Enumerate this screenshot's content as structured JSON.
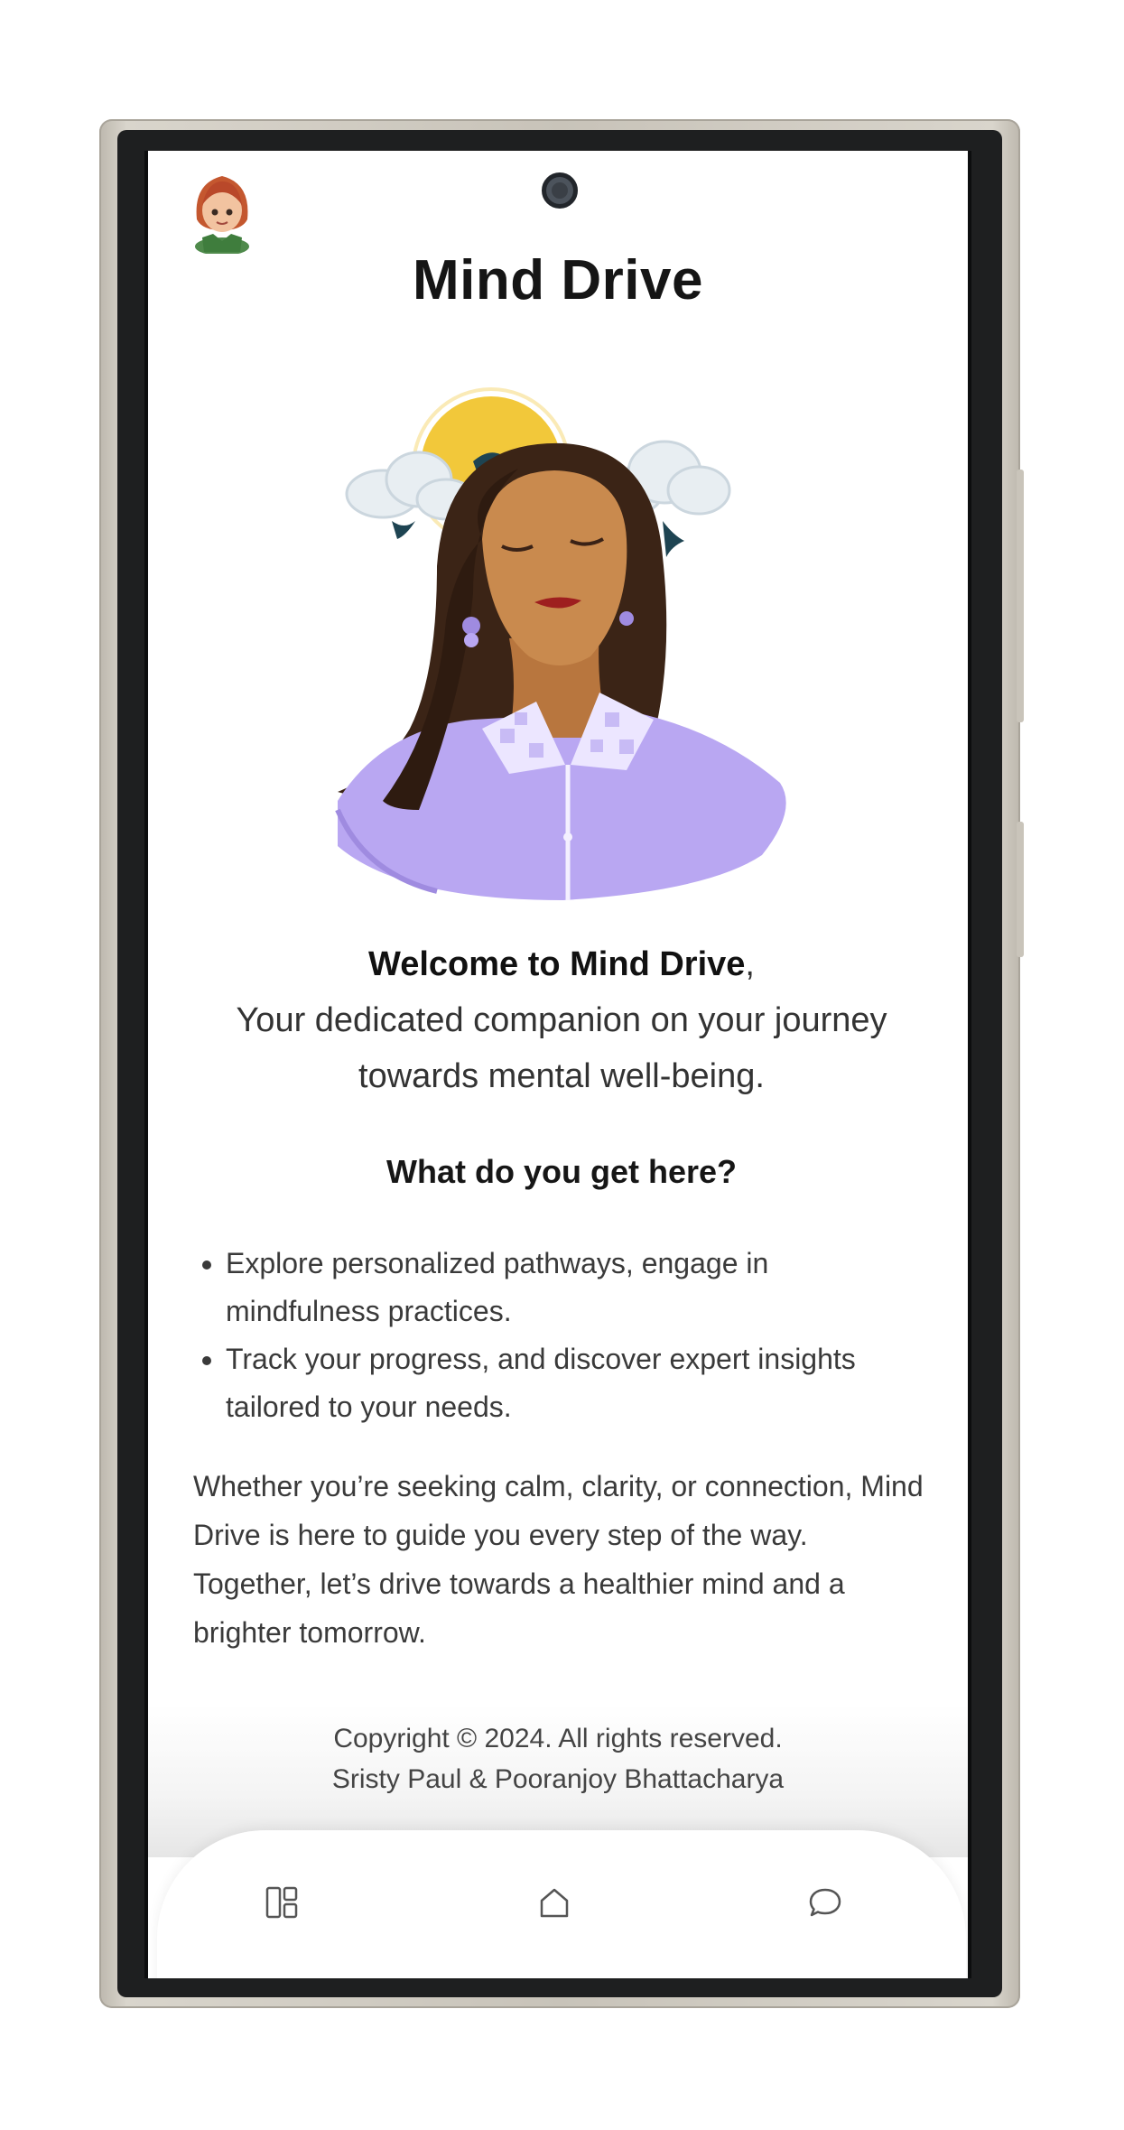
{
  "app": {
    "title": "Mind Drive"
  },
  "intro": {
    "welcome_bold": "Welcome to Mind Drive",
    "welcome_comma": ",",
    "tagline": "Your dedicated companion on your journey towards mental well-being."
  },
  "features": {
    "heading": "What do you get here?",
    "items": [
      "Explore personalized pathways, engage in mindfulness practices.",
      "Track your progress, and discover expert insights tailored to your needs."
    ]
  },
  "closing": "Whether you’re seeking calm, clarity, or connection, Mind Drive is here to guide you every step of the way. Together, let’s drive towards a healthier mind and a brighter tomorrow.",
  "footer": {
    "copyright": "Copyright © 2024. All rights reserved.",
    "authors": "Sristy Paul & Pooranjoy Bhattacharya"
  },
  "nav": {
    "items": [
      {
        "name": "dashboard",
        "icon": "dashboard-icon"
      },
      {
        "name": "home",
        "icon": "home-icon"
      },
      {
        "name": "chat",
        "icon": "chat-bubble-icon"
      }
    ]
  },
  "colors": {
    "shirt": "#b9a7f2",
    "skin": "#c98a4e",
    "hair": "#3b2416",
    "sun": "#f2c83a",
    "accent_text": "#151515"
  }
}
